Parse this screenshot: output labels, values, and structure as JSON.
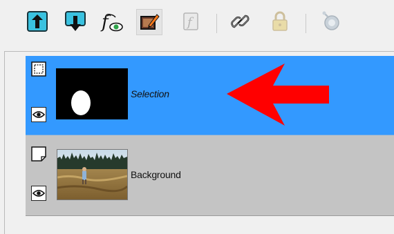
{
  "toolbar": {
    "buttons": [
      {
        "icon": "move-layer-up-icon",
        "enabled": true
      },
      {
        "icon": "move-layer-down-icon",
        "enabled": true
      },
      {
        "icon": "layer-effects-icon",
        "enabled": true
      },
      {
        "icon": "edit-layer-icon",
        "enabled": true,
        "active": true
      },
      {
        "icon": "layer-function-icon",
        "enabled": false
      },
      {
        "icon": "link-layers-icon",
        "enabled": true
      },
      {
        "icon": "lock-layer-icon",
        "enabled": false
      },
      {
        "icon": "layer-mask-icon",
        "enabled": false
      }
    ]
  },
  "layers": [
    {
      "name": "Selection",
      "selected": true,
      "visible": true,
      "type_icon": "selection-layer-icon",
      "thumbnail": "selection-mask-thumbnail"
    },
    {
      "name": "Background",
      "selected": false,
      "visible": true,
      "type_icon": "image-layer-icon",
      "thumbnail": "photo-thumbnail"
    }
  ],
  "colors": {
    "selected_row": "#3399ff",
    "unselected_row": "#c4c4c4",
    "annotation_arrow": "#ff0000"
  }
}
